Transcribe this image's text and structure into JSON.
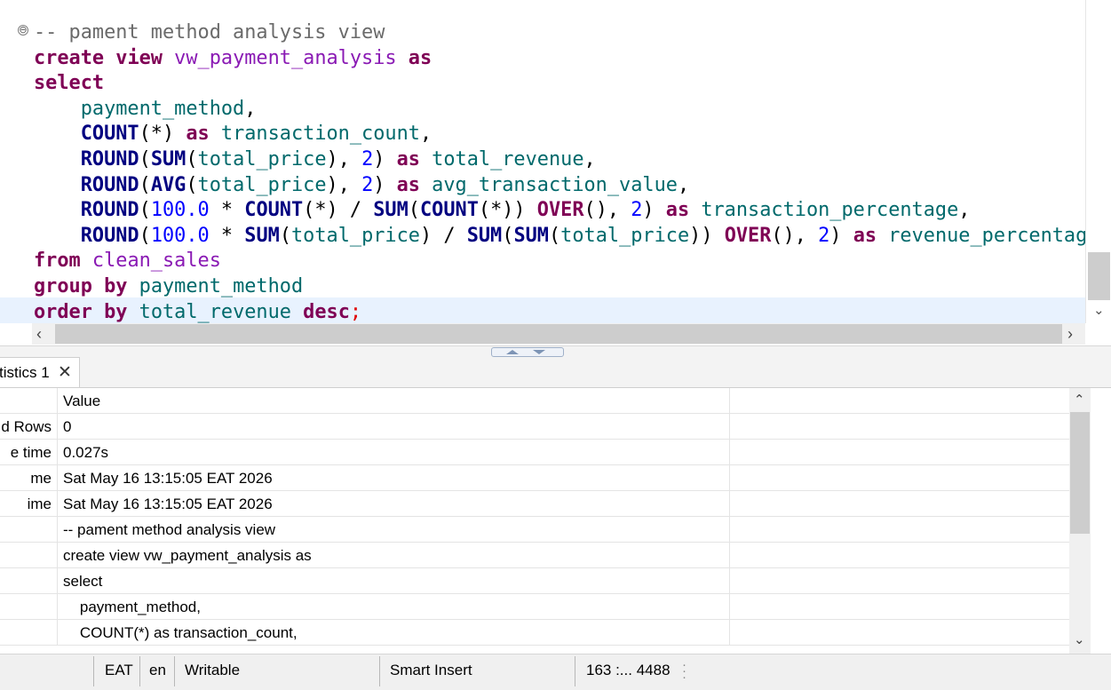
{
  "editor": {
    "lines": [
      [
        [
          "cmt",
          "-- pament method analysis view"
        ]
      ],
      [
        [
          "kw",
          "create"
        ],
        [
          "op",
          " "
        ],
        [
          "kw",
          "view"
        ],
        [
          "op",
          " "
        ],
        [
          "obj",
          "vw_payment_analysis"
        ],
        [
          "op",
          " "
        ],
        [
          "kw",
          "as"
        ]
      ],
      [
        [
          "kw",
          "select"
        ]
      ],
      [
        [
          "op",
          "    "
        ],
        [
          "id",
          "payment_method"
        ],
        [
          "op",
          ","
        ]
      ],
      [
        [
          "op",
          "    "
        ],
        [
          "fn",
          "COUNT"
        ],
        [
          "op",
          "(*) "
        ],
        [
          "kw",
          "as"
        ],
        [
          "op",
          " "
        ],
        [
          "id",
          "transaction_count"
        ],
        [
          "op",
          ","
        ]
      ],
      [
        [
          "op",
          "    "
        ],
        [
          "fn",
          "ROUND"
        ],
        [
          "op",
          "("
        ],
        [
          "fn",
          "SUM"
        ],
        [
          "op",
          "("
        ],
        [
          "id",
          "total_price"
        ],
        [
          "op",
          "), "
        ],
        [
          "num",
          "2"
        ],
        [
          "op",
          ") "
        ],
        [
          "kw",
          "as"
        ],
        [
          "op",
          " "
        ],
        [
          "id",
          "total_revenue"
        ],
        [
          "op",
          ","
        ]
      ],
      [
        [
          "op",
          "    "
        ],
        [
          "fn",
          "ROUND"
        ],
        [
          "op",
          "("
        ],
        [
          "fn",
          "AVG"
        ],
        [
          "op",
          "("
        ],
        [
          "id",
          "total_price"
        ],
        [
          "op",
          "), "
        ],
        [
          "num",
          "2"
        ],
        [
          "op",
          ") "
        ],
        [
          "kw",
          "as"
        ],
        [
          "op",
          " "
        ],
        [
          "id",
          "avg_transaction_value"
        ],
        [
          "op",
          ","
        ]
      ],
      [
        [
          "op",
          "    "
        ],
        [
          "fn",
          "ROUND"
        ],
        [
          "op",
          "("
        ],
        [
          "num",
          "100.0"
        ],
        [
          "op",
          " * "
        ],
        [
          "fn",
          "COUNT"
        ],
        [
          "op",
          "(*) / "
        ],
        [
          "fn",
          "SUM"
        ],
        [
          "op",
          "("
        ],
        [
          "fn",
          "COUNT"
        ],
        [
          "op",
          "(*)) "
        ],
        [
          "kw",
          "OVER"
        ],
        [
          "op",
          "(), "
        ],
        [
          "num",
          "2"
        ],
        [
          "op",
          ") "
        ],
        [
          "kw",
          "as"
        ],
        [
          "op",
          " "
        ],
        [
          "id",
          "transaction_percentage"
        ],
        [
          "op",
          ","
        ]
      ],
      [
        [
          "op",
          "    "
        ],
        [
          "fn",
          "ROUND"
        ],
        [
          "op",
          "("
        ],
        [
          "num",
          "100.0"
        ],
        [
          "op",
          " * "
        ],
        [
          "fn",
          "SUM"
        ],
        [
          "op",
          "("
        ],
        [
          "id",
          "total_price"
        ],
        [
          "op",
          ") / "
        ],
        [
          "fn",
          "SUM"
        ],
        [
          "op",
          "("
        ],
        [
          "fn",
          "SUM"
        ],
        [
          "op",
          "("
        ],
        [
          "id",
          "total_price"
        ],
        [
          "op",
          ")) "
        ],
        [
          "kw",
          "OVER"
        ],
        [
          "op",
          "(), "
        ],
        [
          "num",
          "2"
        ],
        [
          "op",
          ") "
        ],
        [
          "kw",
          "as"
        ],
        [
          "op",
          " "
        ],
        [
          "id",
          "revenue_percentage"
        ]
      ],
      [
        [
          "kw",
          "from"
        ],
        [
          "op",
          " "
        ],
        [
          "obj",
          "clean_sales"
        ]
      ],
      [
        [
          "kw",
          "group"
        ],
        [
          "op",
          " "
        ],
        [
          "kw",
          "by"
        ],
        [
          "op",
          " "
        ],
        [
          "id",
          "payment_method"
        ]
      ],
      [
        [
          "kw",
          "order"
        ],
        [
          "op",
          " "
        ],
        [
          "kw",
          "by"
        ],
        [
          "op",
          " "
        ],
        [
          "id",
          "total_revenue"
        ],
        [
          "op",
          " "
        ],
        [
          "kw",
          "desc"
        ],
        [
          "semi",
          ";"
        ]
      ]
    ],
    "fold_marker": "⊖"
  },
  "result_tab": {
    "label": "tistics 1",
    "close": "✕"
  },
  "table": {
    "header": {
      "name": "",
      "value": "Value"
    },
    "rows": [
      {
        "name": "d Rows",
        "value": "0"
      },
      {
        "name": "e time",
        "value": "0.027s"
      },
      {
        "name": "me",
        "value": "Sat May 16 13:15:05 EAT 2026"
      },
      {
        "name": "ime",
        "value": "Sat May 16 13:15:05 EAT 2026"
      },
      {
        "name": "",
        "value": "-- pament method analysis view"
      },
      {
        "name": "",
        "value": "create view vw_payment_analysis as"
      },
      {
        "name": "",
        "value": "select"
      },
      {
        "name": "",
        "value": "    payment_method,"
      },
      {
        "name": "",
        "value": "    COUNT(*) as transaction_count,"
      }
    ]
  },
  "statusbar": {
    "timezone": "EAT",
    "language": "en",
    "mode": "Writable",
    "insert_mode": "Smart Insert",
    "position": "163 :... 4488"
  }
}
